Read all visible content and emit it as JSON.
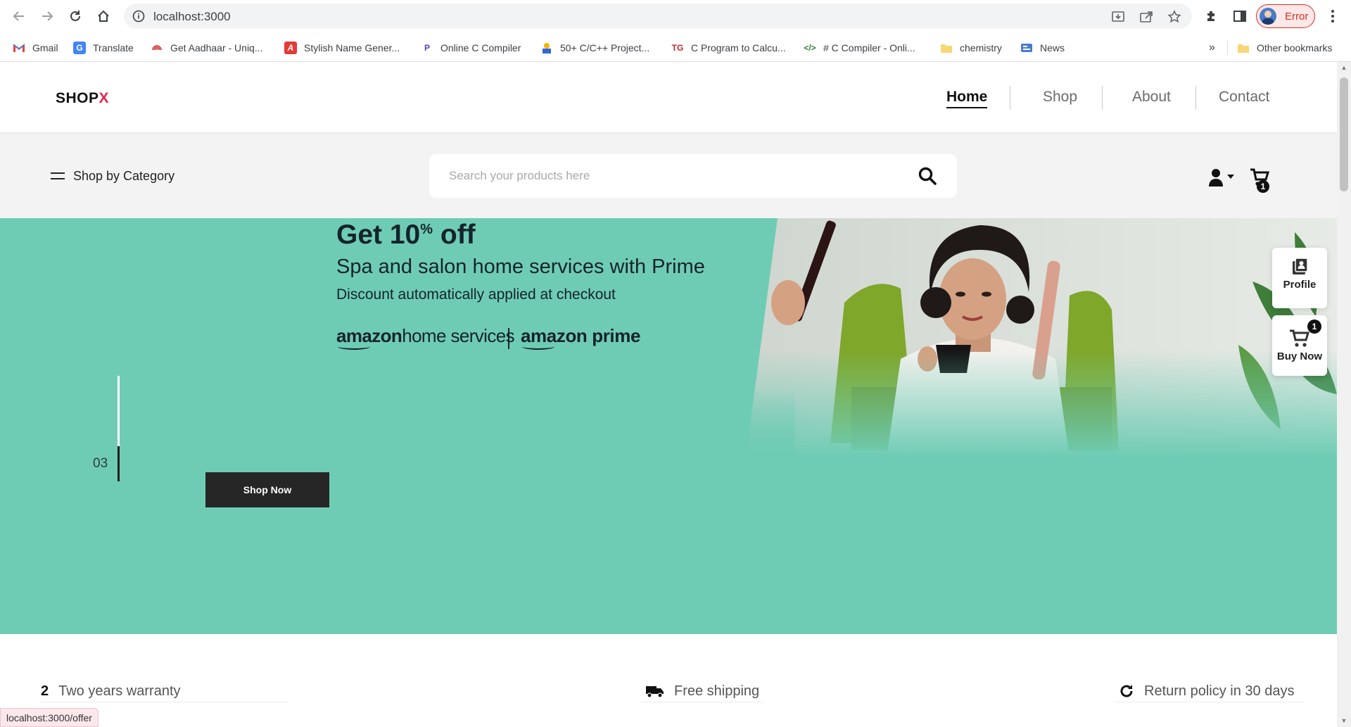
{
  "browser": {
    "url": "localhost:3000",
    "profile_status": "Error",
    "bookmarks": [
      {
        "label": "Gmail",
        "icon": "gmail-icon"
      },
      {
        "label": "Translate",
        "icon": "translate-icon"
      },
      {
        "label": "Get Aadhaar - Uniq...",
        "icon": "aadhaar-icon"
      },
      {
        "label": "Stylish Name Gener...",
        "icon": "stylish-name-icon"
      },
      {
        "label": "Online C Compiler",
        "icon": "programiz-icon"
      },
      {
        "label": "50+ C/C++ Project...",
        "icon": "projects-icon"
      },
      {
        "label": "C Program to Calcu...",
        "icon": "tg-icon"
      },
      {
        "label": "# C Compiler - Onli...",
        "icon": "code-icon"
      },
      {
        "label": "chemistry",
        "icon": "folder-icon"
      },
      {
        "label": "News",
        "icon": "news-icon"
      }
    ],
    "more_bookmarks": "»",
    "other_bookmarks": "Other bookmarks",
    "status_url": "localhost:3000/offer"
  },
  "site": {
    "logo_text": "SHOP",
    "logo_accent": "X",
    "nav": [
      {
        "label": "Home",
        "active": true
      },
      {
        "label": "Shop",
        "active": false
      },
      {
        "label": "About",
        "active": false
      },
      {
        "label": "Contact",
        "active": false
      }
    ],
    "category_label": "Shop by Category",
    "search_placeholder": "Search your products here",
    "cart_count": "1"
  },
  "hero": {
    "promo_title": "Get 10",
    "promo_title_sup": "%",
    "promo_title_end": " off",
    "promo_sub": "Spa and salon home services with Prime",
    "promo_note": "Discount automatically applied at checkout",
    "brand_left_bold": "amazon",
    "brand_left_rest": "home services",
    "brand_right": "amazon prime",
    "slide_number": "03",
    "cta_label": "Shop Now",
    "background_color": "#6fccb4"
  },
  "side_widgets": {
    "profile_label": "Profile",
    "buy_label": "Buy Now",
    "buy_count": "1"
  },
  "features": [
    {
      "icon_text": "2",
      "label": "Two years warranty"
    },
    {
      "icon": "truck-icon",
      "label": "Free shipping"
    },
    {
      "icon": "refresh-icon",
      "label": "Return policy in 30 days"
    }
  ]
}
